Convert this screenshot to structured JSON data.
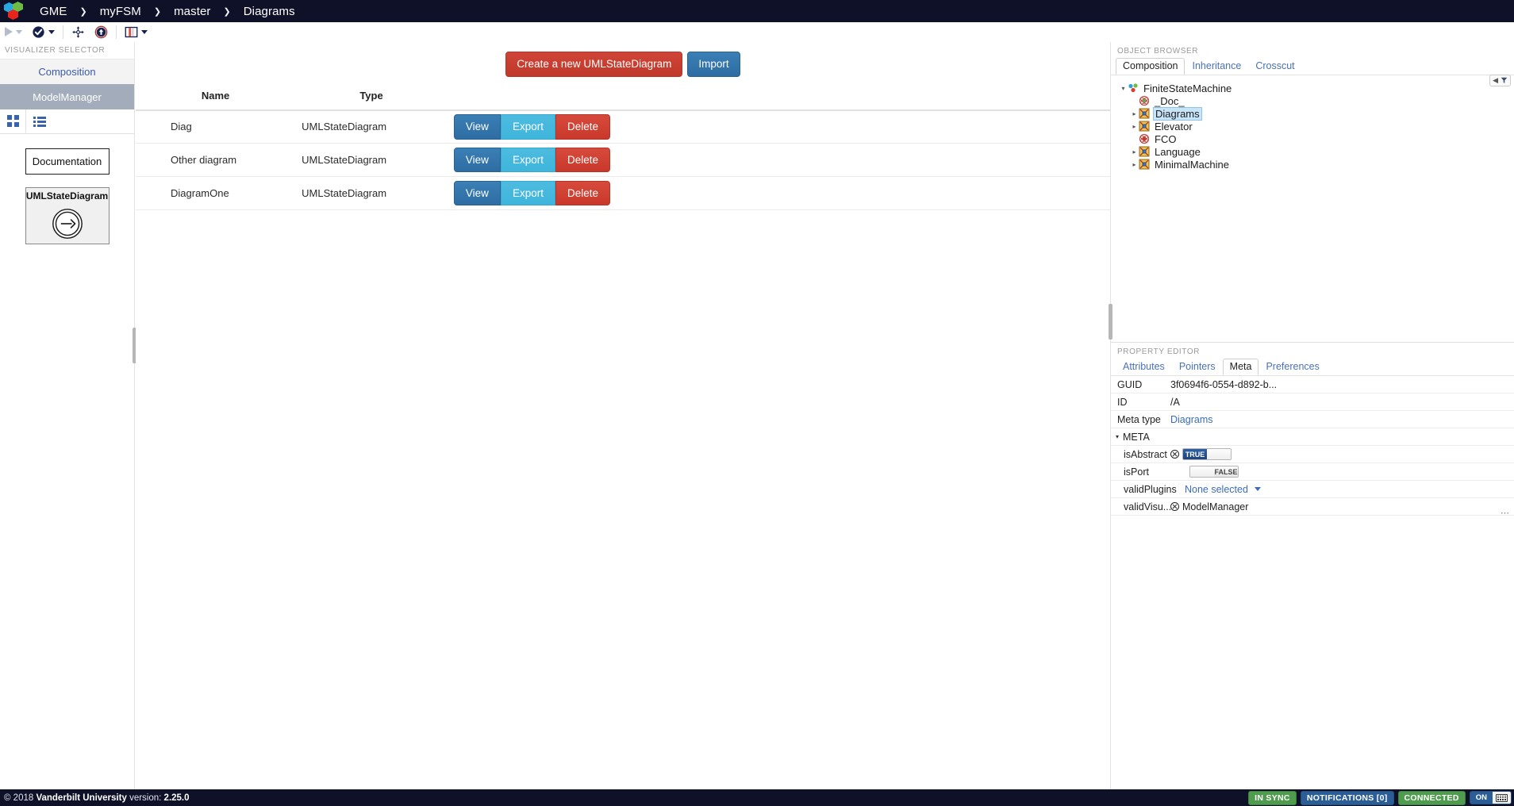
{
  "topnav": {
    "logo_name": "gme-logo",
    "breadcrumbs": [
      "GME",
      "myFSM",
      "master",
      "Diagrams"
    ],
    "separator": "❯"
  },
  "toolbar": {
    "items": [
      {
        "name": "run-plugin-button",
        "icon": "play-icon",
        "label": ""
      },
      {
        "name": "check-model-button",
        "icon": "check-circle-icon",
        "label": ""
      },
      {
        "name": "layout-button",
        "icon": "move-arrows-icon",
        "label": ""
      },
      {
        "name": "upload-button",
        "icon": "upload-circle-icon",
        "label": ""
      },
      {
        "name": "panel-layout-button",
        "icon": "columns-icon",
        "label": ""
      }
    ]
  },
  "left_panel": {
    "title": "VISUALIZER SELECTOR",
    "visualizers": [
      {
        "label": "Composition",
        "selected": false
      },
      {
        "label": "ModelManager",
        "selected": true
      }
    ],
    "view_toggles": [
      {
        "name": "grid-view-toggle",
        "icon": "grid-icon",
        "active": true
      },
      {
        "name": "list-view-toggle",
        "icon": "list-icon",
        "active": false
      }
    ],
    "documentation_label": "Documentation",
    "part_card": {
      "title": "UMLStateDiagram",
      "icon": "state-transition-arrow-icon"
    }
  },
  "main": {
    "buttons": {
      "create_label": "Create a new UMLStateDiagram",
      "import_label": "Import"
    },
    "table": {
      "headers": [
        "Name",
        "Type",
        ""
      ],
      "row_action_labels": {
        "view": "View",
        "export": "Export",
        "delete": "Delete"
      },
      "rows": [
        {
          "name": "Diag",
          "type": "UMLStateDiagram"
        },
        {
          "name": "Other diagram",
          "type": "UMLStateDiagram"
        },
        {
          "name": "DiagramOne",
          "type": "UMLStateDiagram"
        }
      ]
    }
  },
  "object_browser": {
    "title": "OBJECT BROWSER",
    "tabs": [
      {
        "label": "Composition",
        "active": true
      },
      {
        "label": "Inheritance",
        "active": false
      },
      {
        "label": "Crosscut",
        "active": false
      }
    ],
    "filter_icon": "filter-icon",
    "tree": [
      {
        "label": "FiniteStateMachine",
        "depth": 0,
        "expander": "▾",
        "icon": "model-root-icon",
        "selected": false
      },
      {
        "label": "_Doc_",
        "depth": 1,
        "expander": "",
        "icon": "fco-atom-icon",
        "selected": false
      },
      {
        "label": "Diagrams",
        "depth": 1,
        "expander": "▸",
        "icon": "model-icon",
        "selected": true
      },
      {
        "label": "Elevator",
        "depth": 1,
        "expander": "▸",
        "icon": "model-icon",
        "selected": false
      },
      {
        "label": "FCO",
        "depth": 1,
        "expander": "",
        "icon": "fco-atom-icon",
        "selected": false
      },
      {
        "label": "Language",
        "depth": 0,
        "expander": "▸",
        "icon": "model-icon",
        "selected": false
      },
      {
        "label": "MinimalMachine",
        "depth": 0,
        "expander": "▸",
        "icon": "model-icon",
        "selected": false
      }
    ]
  },
  "property_editor": {
    "title": "PROPERTY EDITOR",
    "tabs": [
      {
        "label": "Attributes",
        "active": false
      },
      {
        "label": "Pointers",
        "active": false
      },
      {
        "label": "Meta",
        "active": true
      },
      {
        "label": "Preferences",
        "active": false
      }
    ],
    "rows": [
      {
        "key": "GUID",
        "value": "3f0694f6-0554-d892-b...",
        "kind": "text"
      },
      {
        "key": "ID",
        "value": "/A",
        "kind": "text"
      },
      {
        "key": "Meta type",
        "value": "Diagrams",
        "kind": "link"
      }
    ],
    "meta_section": {
      "label": "META",
      "caret": "▾",
      "rows": [
        {
          "key": "isAbstract",
          "kind": "toggle",
          "value": "TRUE",
          "off_label": "",
          "has_reset": true
        },
        {
          "key": "isPort",
          "kind": "toggle",
          "value": "FALSE",
          "off_label": "FALSE",
          "has_reset": false
        },
        {
          "key": "validPlugins",
          "kind": "dropdown",
          "value": "None selected"
        },
        {
          "key": "validVisu...",
          "kind": "reset-text",
          "value": "ModelManager",
          "has_reset": true
        }
      ],
      "overflow": "⋯"
    }
  },
  "status_bar": {
    "copyright_prefix": "© 2018 ",
    "copyright_org": "Vanderbilt University",
    "version_label": "version:",
    "version_value": "2.25.0",
    "badges": [
      {
        "label": "IN SYNC",
        "color": "green"
      },
      {
        "label": "NOTIFICATIONS [0]",
        "color": "blue"
      },
      {
        "label": "CONNECTED",
        "color": "green"
      }
    ],
    "switch": {
      "on_label": "ON",
      "icon": "keyboard-icon"
    }
  },
  "colors": {
    "nav_bg": "#0f1128",
    "danger": "#c0392b",
    "primary": "#2e6da4",
    "info": "#3fb5db",
    "success": "#4f9c4f",
    "selected_tree": "#c8e4f8",
    "visualizer_active": "#a3acba"
  }
}
